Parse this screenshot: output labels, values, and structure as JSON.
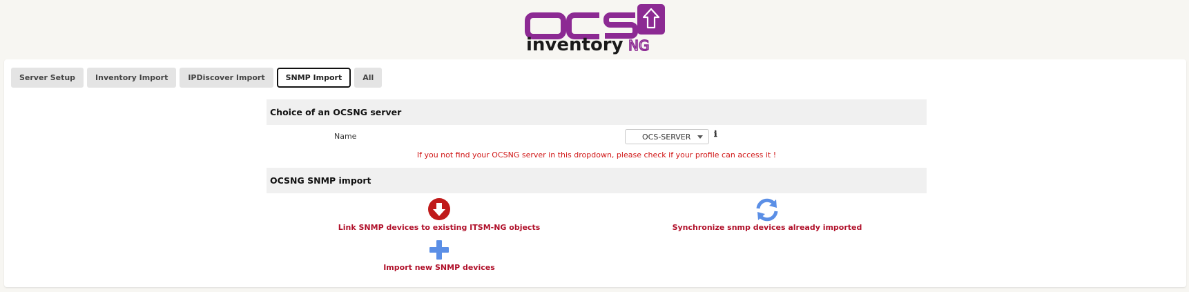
{
  "logo": {
    "text_main": "OCS",
    "text_sub": "inventory",
    "text_ng": "NG"
  },
  "tabs": [
    {
      "label": "Server Setup",
      "active": false
    },
    {
      "label": "Inventory Import",
      "active": false
    },
    {
      "label": "IPDiscover Import",
      "active": false
    },
    {
      "label": "SNMP Import",
      "active": true
    },
    {
      "label": "All",
      "active": false
    }
  ],
  "server_section": {
    "title": "Choice of an OCSNG server",
    "name_label": "Name",
    "selected_server": "OCS-SERVER",
    "info_icon": "ℹ",
    "warning": "If you not find your OCSNG server in this dropdown, please check if your profile can access it !"
  },
  "snmp_section": {
    "title": "OCSNG SNMP import",
    "actions": {
      "link": {
        "label": "Link SNMP devices to existing ITSM-NG objects",
        "icon": "arrow-down-circle-icon"
      },
      "sync": {
        "label": "Synchronize snmp devices already imported",
        "icon": "sync-icon"
      },
      "import": {
        "label": "Import new SNMP devices",
        "icon": "plus-icon"
      }
    }
  },
  "colors": {
    "brand_purple": "#8c2a93",
    "action_red": "#b0102a",
    "warning_red": "#d01515",
    "icon_blue": "#5b8fe6",
    "icon_red": "#c01a1a"
  }
}
